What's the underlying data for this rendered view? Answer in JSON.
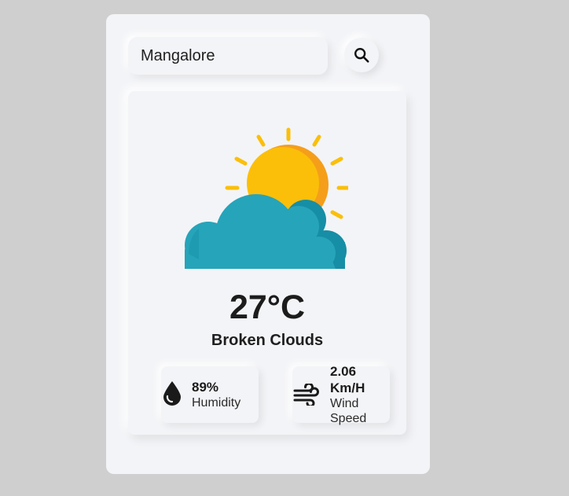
{
  "search": {
    "value": "Mangalore"
  },
  "weather": {
    "temperature": "27°C",
    "condition": "Broken Clouds",
    "icon": "sun-behind-cloud"
  },
  "humidity": {
    "value": "89%",
    "label": "Humidity",
    "icon": "water-drop-icon"
  },
  "wind": {
    "value_line1": "2.06",
    "value_line2": "Km/H",
    "label_line1": "Wind",
    "label_line2": "Speed",
    "icon": "wind-icon"
  },
  "colors": {
    "background": "#cfcfcf",
    "panel": "#f3f4f7",
    "sun": "#fbbf0a",
    "sun_shade": "#f59e1a",
    "cloud": "#26a4ba",
    "cloud_shade": "#168ea6",
    "text": "#1c1c1c"
  }
}
